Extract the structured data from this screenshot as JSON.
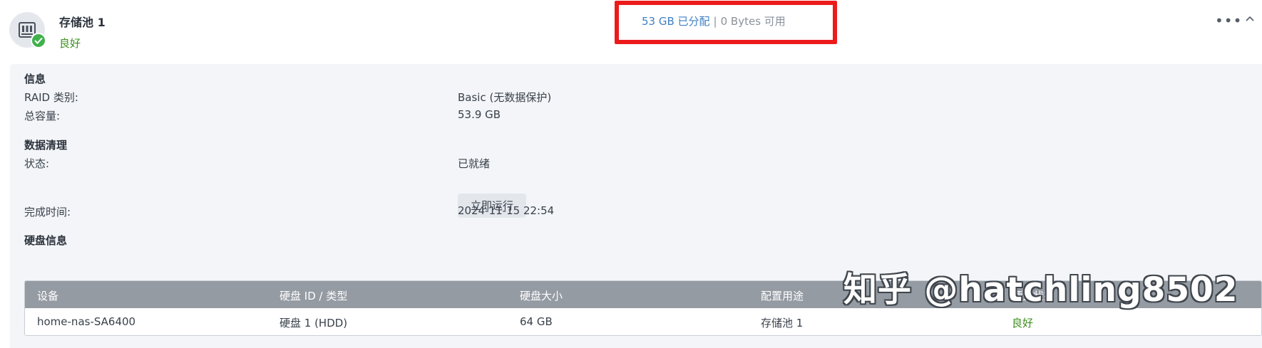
{
  "pool": {
    "title": "存储池 1",
    "status": "良好",
    "icon": "storage-pool-icon",
    "status_icon": "check-icon",
    "allocated": "53 GB 已分配",
    "separator": "|",
    "available": "0 Bytes 可用",
    "more_icon": "more-horizontal-icon",
    "collapse_icon": "chevron-up-icon"
  },
  "info": {
    "section_title": "信息",
    "raid_label": "RAID 类别:",
    "raid_value": "Basic (无数据保护)",
    "capacity_label": "总容量:",
    "capacity_value": "53.9 GB"
  },
  "scrub": {
    "section_title": "数据清理",
    "state_label": "状态:",
    "state_value": "已就绪",
    "run_button": "立即运行",
    "finished_label": "完成时间:",
    "finished_value": "2024-11-15 22:54"
  },
  "disks": {
    "section_title": "硬盘信息",
    "columns": [
      "设备",
      "硬盘 ID / 类型",
      "硬盘大小",
      "配置用途",
      "硬盘状态"
    ],
    "rows": [
      [
        "home-nas-SA6400",
        "硬盘 1 (HDD)",
        "64 GB",
        "存储池 1",
        "良好"
      ]
    ]
  },
  "watermark": "知乎 @hatchling8502",
  "colors": {
    "accent": "#3f80c2",
    "good": "#3c8f1c",
    "highlight": "#ec1b1b",
    "table_header": "#959ba3",
    "panel_bg": "#f3f5f8"
  }
}
